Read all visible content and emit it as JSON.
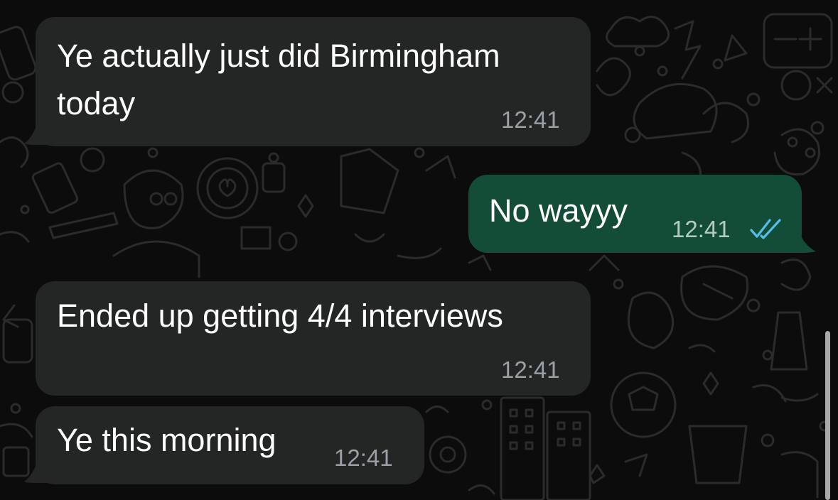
{
  "messages": [
    {
      "direction": "incoming",
      "lines": [
        "Ye actually just did Birmingham",
        "today"
      ],
      "time": "12:41"
    },
    {
      "direction": "outgoing",
      "text": "No wayyy",
      "time": "12:41",
      "status": "read",
      "status_icon": "double-check-icon"
    },
    {
      "direction": "incoming",
      "text": "Ended up getting 4/4 interviews",
      "time": "12:41"
    },
    {
      "direction": "incoming",
      "text": "Ye this morning",
      "time": "12:41"
    }
  ],
  "colors": {
    "background": "#0c0c0c",
    "incoming_bubble": "#242626",
    "outgoing_bubble": "#134d37",
    "timestamp": "#9aa0a6",
    "read_ticks": "#53bdeb",
    "doodle_lines": "#2a2a2a"
  }
}
